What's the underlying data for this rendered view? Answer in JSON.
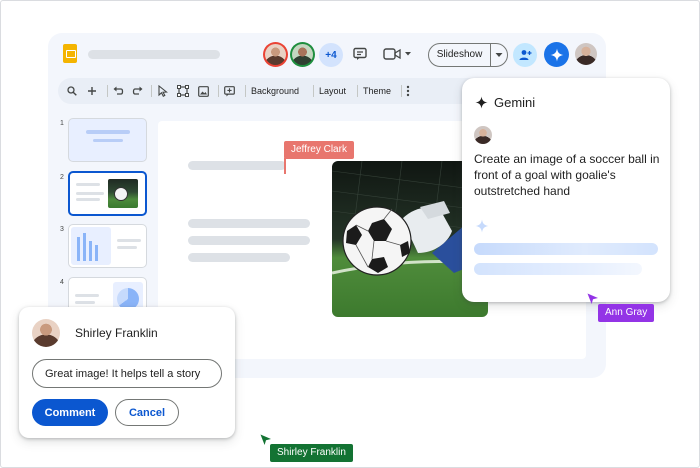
{
  "colors": {
    "accent": "#0b57d0",
    "gemini": "#1a73e8",
    "jeffrey_tag": "#e8766e",
    "ann_tag": "#9334e6",
    "shirley_tag": "#137333"
  },
  "toolbar": {
    "icons": [
      "search-icon",
      "plus-icon",
      "undo-icon",
      "redo-icon",
      "cursor-icon",
      "select-frame-icon",
      "image-icon",
      "comment-add-icon"
    ],
    "background_label": "Background",
    "layout_label": "Layout",
    "theme_label": "Theme"
  },
  "header": {
    "more_collaborators": "+4",
    "slideshow_label": "Slideshow",
    "icons": [
      "comments-icon",
      "video-camera-icon",
      "add-person-icon",
      "gemini-spark-icon"
    ]
  },
  "filmstrip": {
    "slides": [
      {
        "number": "1"
      },
      {
        "number": "2"
      },
      {
        "number": "3"
      },
      {
        "number": "4"
      }
    ]
  },
  "collaborators": {
    "jeffrey": "Jeffrey Clark",
    "ann": "Ann Gray",
    "shirley": "Shirley Franklin"
  },
  "gemini": {
    "title": "Gemini",
    "prompt": "Create an image of a soccer ball in front of a goal with goalie's outstretched hand"
  },
  "comment": {
    "author": "Shirley Franklin",
    "input_value": "Great image! It helps tell a story",
    "comment_label": "Comment",
    "cancel_label": "Cancel"
  }
}
